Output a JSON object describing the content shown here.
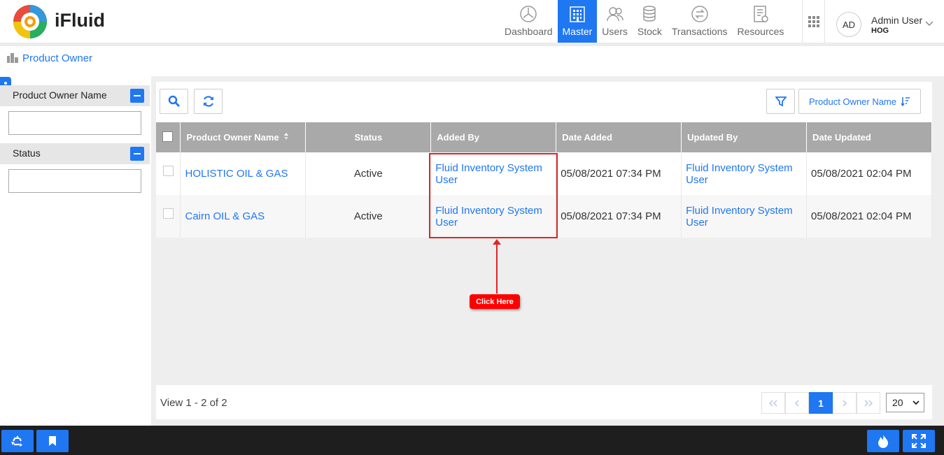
{
  "app": {
    "brand": "iFluid"
  },
  "nav": [
    {
      "label": "Dashboard",
      "icon": "speedometer-icon",
      "active": false
    },
    {
      "label": "Master",
      "icon": "building-icon",
      "active": true
    },
    {
      "label": "Users",
      "icon": "users-icon",
      "active": false
    },
    {
      "label": "Stock",
      "icon": "stack-icon",
      "active": false
    },
    {
      "label": "Transactions",
      "icon": "exchange-icon",
      "active": false
    },
    {
      "label": "Resources",
      "icon": "document-icon",
      "active": false
    }
  ],
  "user": {
    "initials": "AD",
    "name": "Admin User",
    "org": "HOG"
  },
  "breadcrumb": {
    "title": "Product Owner"
  },
  "filters": [
    {
      "label": "Product Owner Name",
      "value": ""
    },
    {
      "label": "Status",
      "value": ""
    }
  ],
  "toolbar": {
    "sort_label": "Product Owner Name"
  },
  "table": {
    "columns": [
      "Product Owner Name",
      "Status",
      "Added By",
      "Date Added",
      "Updated By",
      "Date Updated"
    ],
    "rows": [
      {
        "name": "HOLISTIC OIL & GAS",
        "status": "Active",
        "added_by": "Fluid Inventory System User",
        "date_added": "05/08/2021 07:34 PM",
        "updated_by": "Fluid Inventory System User",
        "date_updated": "05/08/2021 02:04 PM"
      },
      {
        "name": "Cairn OIL & GAS",
        "status": "Active",
        "added_by": "Fluid Inventory System User",
        "date_added": "05/08/2021 07:34 PM",
        "updated_by": "Fluid Inventory System User",
        "date_updated": "05/08/2021 02:04 PM"
      }
    ]
  },
  "annotation": {
    "label": "Click Here",
    "color": "#ff0000"
  },
  "pagination": {
    "summary": "View 1 - 2 of 2",
    "current_page": "1",
    "page_size": "20"
  },
  "colors": {
    "accent": "#1f77f2",
    "header_bg": "#a9a9a9",
    "bottom_bar": "#1e1e1e"
  }
}
